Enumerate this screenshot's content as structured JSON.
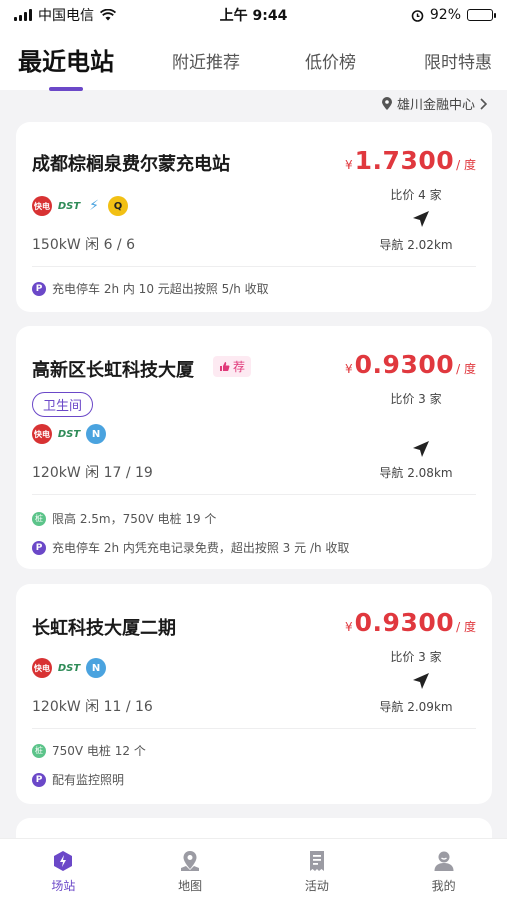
{
  "status_bar": {
    "carrier": "中国电信",
    "time": "上午 9:44",
    "battery": "92%",
    "battery_level": 0.92
  },
  "tabs": [
    {
      "label": "最近电站",
      "active": true
    },
    {
      "label": "附近推荐",
      "active": false
    },
    {
      "label": "低价榜",
      "active": false
    },
    {
      "label": "限时特惠",
      "active": false
    }
  ],
  "location": {
    "label": "雄川金融中心",
    "icon": "location-pin-icon"
  },
  "stations": [
    {
      "name": "成都棕榈泉费尔蒙充电站",
      "price_symbol": "¥",
      "price": "1.7300",
      "price_unit": "/ 度",
      "compare": "比价 4 家",
      "distance": "导航 2.02km",
      "power": "150kW  闲 6 / 6",
      "operators": [
        "快电",
        "DST",
        "lightning",
        "Q"
      ],
      "notes": [
        {
          "type": "P",
          "text": "充电停车 2h 内 10 元超出按照 5/h 收取"
        }
      ]
    },
    {
      "name": "高新区长虹科技大厦",
      "recommend": "荐",
      "tag": "卫生间",
      "price_symbol": "¥",
      "price": "0.9300",
      "price_unit": "/ 度",
      "compare": "比价 3 家",
      "distance": "导航 2.08km",
      "power": "120kW  闲 17 / 19",
      "operators": [
        "快电",
        "DST",
        "N"
      ],
      "notes": [
        {
          "type": "G",
          "text": "限高 2.5m，750V 电桩 19 个"
        },
        {
          "type": "P",
          "text": "充电停车 2h 内凭充电记录免费，超出按照 3 元 /h 收取"
        }
      ]
    },
    {
      "name": "长虹科技大厦二期",
      "price_symbol": "¥",
      "price": "0.9300",
      "price_unit": "/ 度",
      "compare": "比价 3 家",
      "distance": "导航 2.09km",
      "power": "120kW  闲 11 / 16",
      "operators": [
        "快电",
        "DST",
        "N"
      ],
      "notes": [
        {
          "type": "G",
          "text": "750V 电桩 12 个"
        },
        {
          "type": "P",
          "text": "配有监控照明"
        }
      ]
    }
  ],
  "bottom_nav": [
    {
      "label": "场站",
      "icon": "station-icon",
      "active": true
    },
    {
      "label": "地图",
      "icon": "map-icon",
      "active": false
    },
    {
      "label": "活动",
      "icon": "activity-icon",
      "active": false
    },
    {
      "label": "我的",
      "icon": "profile-icon",
      "active": false
    }
  ],
  "colors": {
    "accent": "#6b48c8",
    "price": "#e0383e"
  }
}
